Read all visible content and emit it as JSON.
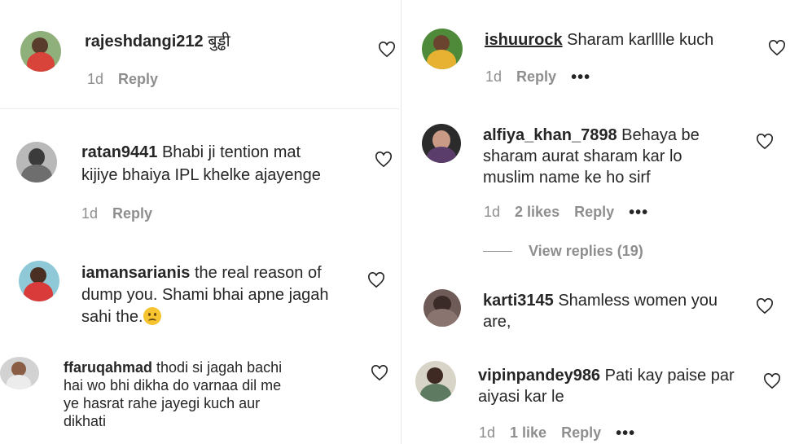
{
  "colors": {
    "text": "#262626",
    "muted": "#8e8e8e",
    "background": "#ffffff"
  },
  "icons": {
    "like": "heart-icon",
    "more": "more-options-icon"
  },
  "left_column": [
    {
      "username": "rajeshdangi212",
      "text_lines": [
        "बुड्ढी"
      ],
      "time": "1d",
      "likes": "",
      "reply": "Reply"
    },
    {
      "username": "ratan9441",
      "text_lines": [
        "Bhabi ji tention mat",
        "kijiye bhaiya IPL khelke ajayenge"
      ],
      "time": "1d",
      "likes": "",
      "reply": "Reply"
    },
    {
      "username": "iamansarianis",
      "text_lines": [
        "the real reason of",
        "dump you. Shami bhai apne jagah",
        "sahi the."
      ],
      "emoji": "sad-face-emoji"
    },
    {
      "username": "ffaruqahmad",
      "text_lines": [
        "thodi si jagah bachi",
        "hai wo bhi dikha do varnaa dil me",
        "ye hasrat rahe jayegi kuch aur",
        "dikhati"
      ]
    }
  ],
  "right_column": [
    {
      "username": "ishuurock",
      "text_lines": [
        "Sharam karlllle kuch"
      ],
      "time": "1d",
      "likes": "",
      "reply": "Reply",
      "more": "•••"
    },
    {
      "username": "alfiya_khan_7898",
      "text_lines": [
        "Behaya be",
        "sharam aurat sharam kar lo",
        "muslim name ke ho sirf"
      ],
      "time": "1d",
      "likes": "2 likes",
      "reply": "Reply",
      "more": "•••"
    },
    {
      "view_replies": "View replies (19)"
    },
    {
      "username": "karti3145",
      "text_lines": [
        "Shamless women you",
        "are,"
      ]
    },
    {
      "username": "vipinpandey986",
      "text_lines": [
        "Pati kay paise par",
        "aiyasi kar le"
      ],
      "time": "1d",
      "likes": "1 like",
      "reply": "Reply",
      "more": "•••"
    }
  ]
}
